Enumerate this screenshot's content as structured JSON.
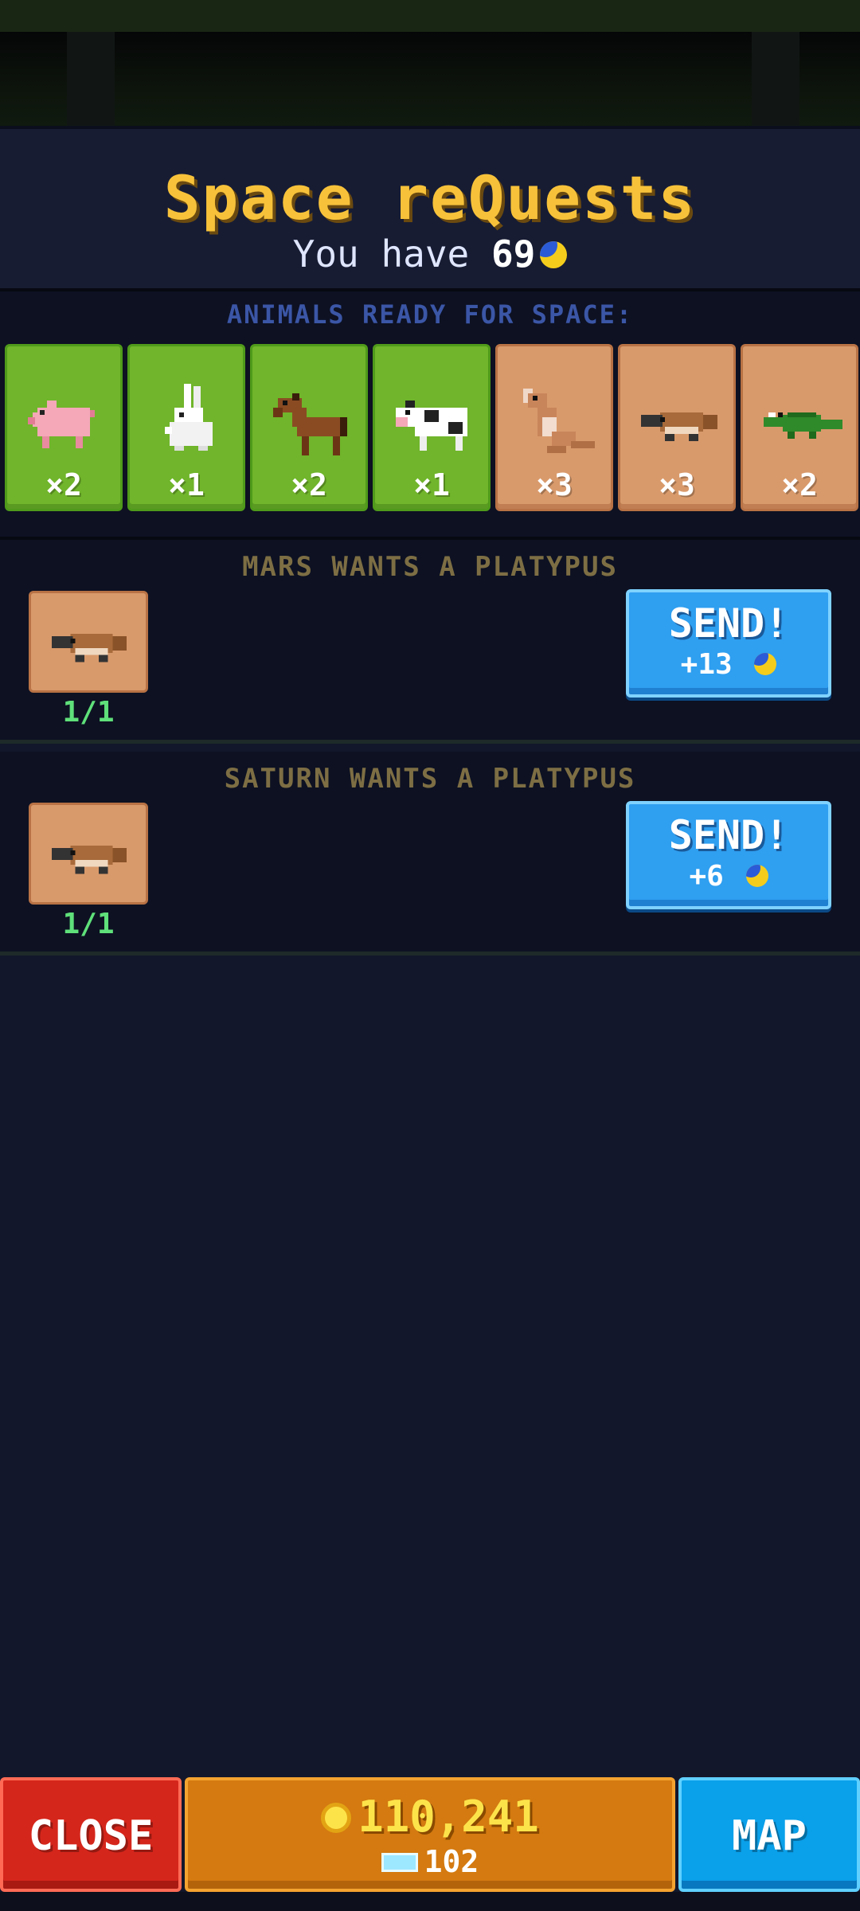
{
  "header": {
    "title": "Space reQuests",
    "balance_prefix": "You have",
    "balance_value": "69",
    "balance_icon": "moon-currency-icon"
  },
  "ready": {
    "label": "ANIMALS READY FOR SPACE:",
    "animals": [
      {
        "name": "pig",
        "count": "×2",
        "bg": "green"
      },
      {
        "name": "rabbit",
        "count": "×1",
        "bg": "green"
      },
      {
        "name": "horse",
        "count": "×2",
        "bg": "green"
      },
      {
        "name": "cow",
        "count": "×1",
        "bg": "green"
      },
      {
        "name": "kangaroo",
        "count": "×3",
        "bg": "clay"
      },
      {
        "name": "platypus",
        "count": "×3",
        "bg": "clay"
      },
      {
        "name": "crocodile",
        "count": "×2",
        "bg": "clay"
      }
    ]
  },
  "requests": [
    {
      "label": "MARS WANTS A PLATYPUS",
      "animal": "platypus",
      "progress": "1/1",
      "button": "SEND!",
      "reward": "+13"
    },
    {
      "label": "SATURN WANTS A PLATYPUS",
      "animal": "platypus",
      "progress": "1/1",
      "button": "SEND!",
      "reward": "+6"
    }
  ],
  "footer": {
    "close_label": "CLOSE",
    "coins": "110,241",
    "gems": "102",
    "map_label": "MAP"
  },
  "colors": {
    "title": "#f7c23a",
    "send_button": "#2f9ff0",
    "close_button": "#d5261b",
    "map_button": "#0aa0ea",
    "currency_panel": "#d47a10"
  }
}
